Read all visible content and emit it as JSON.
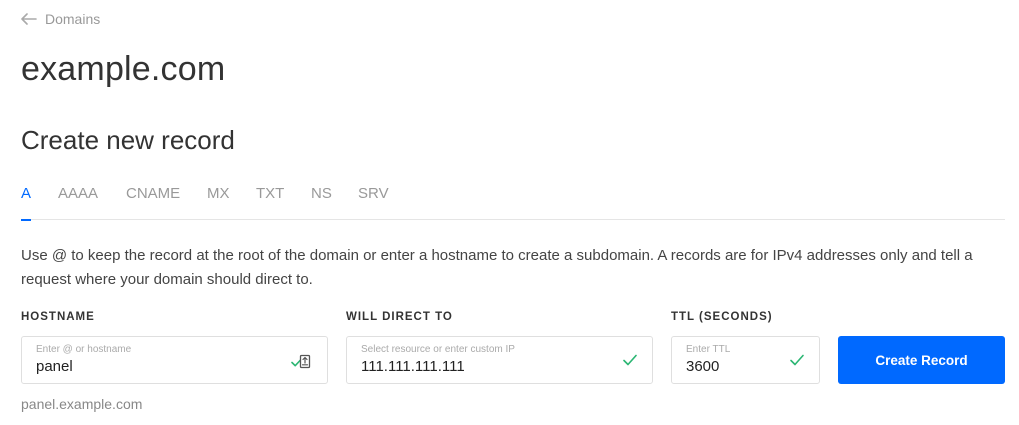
{
  "nav": {
    "back_label": "Domains"
  },
  "page": {
    "title": "example.com",
    "section_title": "Create new record"
  },
  "tabs": [
    {
      "label": "A",
      "active": true
    },
    {
      "label": "AAAA",
      "active": false
    },
    {
      "label": "CNAME",
      "active": false
    },
    {
      "label": "MX",
      "active": false
    },
    {
      "label": "TXT",
      "active": false
    },
    {
      "label": "NS",
      "active": false
    },
    {
      "label": "SRV",
      "active": false
    }
  ],
  "description": "Use @ to keep the record at the root of the domain or enter a hostname to create a subdomain. A records are for IPv4 addresses only and tell a request where your domain should direct to.",
  "form": {
    "hostname": {
      "label": "HOSTNAME",
      "placeholder": "Enter @ or hostname",
      "value": "panel"
    },
    "direct": {
      "label": "WILL DIRECT TO",
      "placeholder": "Select resource or enter custom IP",
      "value": "111.111.111.111"
    },
    "ttl": {
      "label": "TTL (SECONDS)",
      "placeholder": "Enter TTL",
      "value": "3600"
    },
    "submit_label": "Create Record"
  },
  "preview": "panel.example.com",
  "colors": {
    "accent": "#0069ff",
    "success": "#2bb673"
  }
}
